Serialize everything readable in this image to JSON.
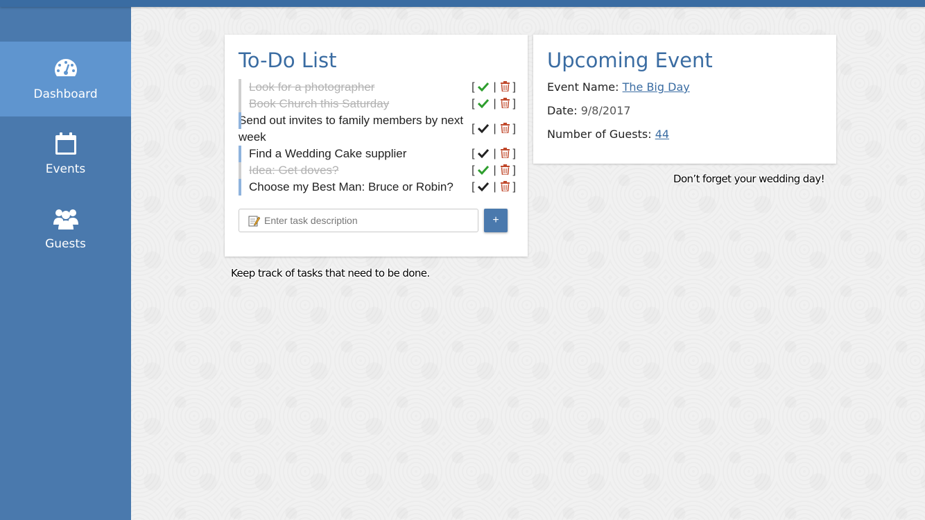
{
  "sidebar": {
    "items": [
      {
        "label": "Dashboard",
        "icon": "dashboard-icon",
        "active": true
      },
      {
        "label": "Events",
        "icon": "calendar-icon",
        "active": false
      },
      {
        "label": "Guests",
        "icon": "users-icon",
        "active": false
      }
    ]
  },
  "todo": {
    "title": "To-Do List",
    "items": [
      {
        "text": "Look for a photographer",
        "done": true
      },
      {
        "text": "Book Church this Saturday",
        "done": true
      },
      {
        "text": "Send out invites to family members by next week",
        "done": false
      },
      {
        "text": "Find a Wedding Cake supplier",
        "done": false
      },
      {
        "text": "Idea: Get doves?",
        "done": true
      },
      {
        "text": "Choose my Best Man: Bruce or Robin?",
        "done": false
      }
    ],
    "input_placeholder": "Enter task description",
    "add_label": "+",
    "bracket_open": "[",
    "bracket_close": "]",
    "separator": "|",
    "caption": "Keep track of tasks that need to be done."
  },
  "event": {
    "title": "Upcoming Event",
    "name_label": "Event Name:",
    "name_value": "The Big Day",
    "date_label": "Date:",
    "date_value": "9/8/2017",
    "guests_label": "Number of Guests:",
    "guests_value": "44",
    "caption": "Don’t forget your wedding day!"
  },
  "colors": {
    "brand": "#4a79ad",
    "active": "#5f95cf",
    "title": "#3a6ca2",
    "check_done": "#2e9e2e",
    "check_pending": "#222222",
    "trash": "#c0492c"
  }
}
